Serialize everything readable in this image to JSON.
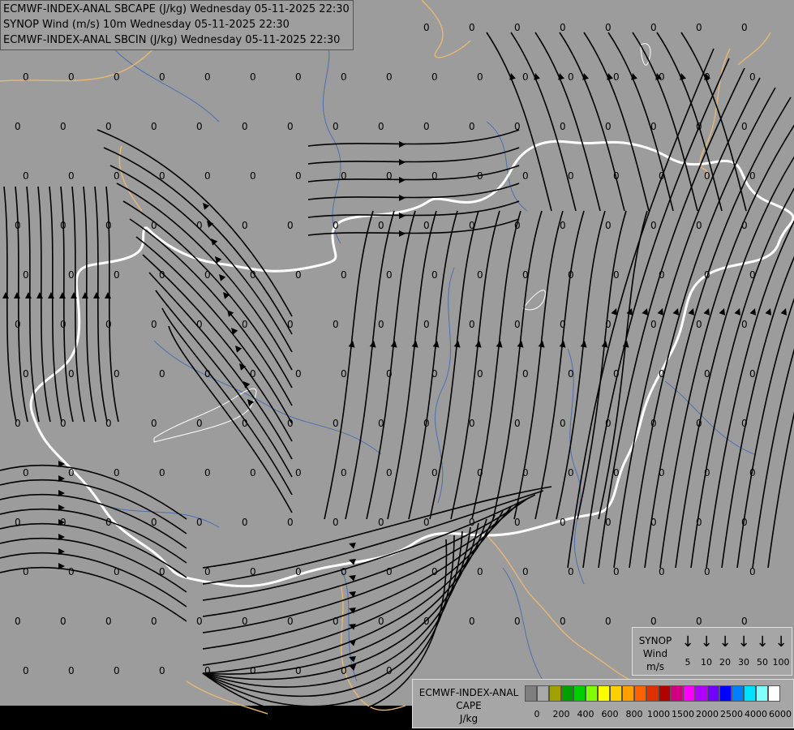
{
  "header": {
    "line1": "ECMWF-INDEX-ANAL SBCAPE (J/kg) Wednesday 05-11-2025 22:30",
    "line2": "SYNOP Wind (m/s) 10m Wednesday 05-11-2025 22:30",
    "line3": "ECMWF-INDEX-ANAL SBCIN (J/kg) Wednesday 05-11-2025 22:30"
  },
  "grid_value": "0",
  "colors": {
    "background": "#9c9c9c",
    "border_national": "#ffffff",
    "border_regional": "#e6b873",
    "river": "#4d6fb0",
    "streamline": "#000000"
  },
  "legend_wind": {
    "title_line1": "SYNOP",
    "title_line2": "Wind",
    "title_line3": "m/s",
    "values": [
      "5",
      "10",
      "20",
      "30",
      "50",
      "100"
    ],
    "arrow_icon": "down-arrow-icon"
  },
  "legend_cape": {
    "title_line1": "ECMWF-INDEX-ANAL",
    "title_line2": "CAPE",
    "title_line3": "J/kg",
    "ticks": [
      "0",
      "200",
      "400",
      "600",
      "800",
      "1000",
      "1500",
      "2000",
      "2500",
      "4000",
      "6000"
    ],
    "colors": [
      "#7f7f7f",
      "#a8a8a8",
      "#a0a000",
      "#00a000",
      "#00d000",
      "#80ff00",
      "#ffff00",
      "#ffd000",
      "#ffa000",
      "#ff6000",
      "#e03000",
      "#b00000",
      "#d00080",
      "#ff00ff",
      "#b000ff",
      "#7000ff",
      "#0000ff",
      "#0080ff",
      "#00e0ff",
      "#80ffff",
      "#ffffff"
    ]
  }
}
